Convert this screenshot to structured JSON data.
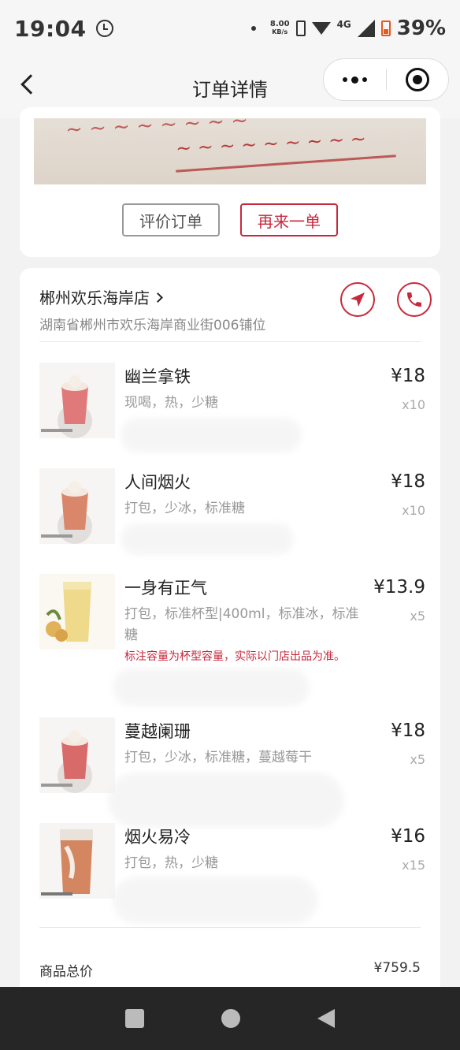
{
  "status_bar": {
    "time": "19:04",
    "net_speed_value": "8.00",
    "net_speed_unit": "KB/s",
    "network": "4G",
    "battery": "39%"
  },
  "nav": {
    "title": "订单详情"
  },
  "actions": {
    "review_label": "评价订单",
    "reorder_label": "再来一单"
  },
  "store": {
    "name": "郴州欢乐海岸店",
    "address": "湖南省郴州市欢乐海岸商业街006铺位"
  },
  "items": [
    {
      "name": "幽兰拿铁",
      "spec": "现喝，热，少糖",
      "note": "",
      "price": "¥18",
      "qty": "x10",
      "icon": "latte-drink-icon"
    },
    {
      "name": "人间烟火",
      "spec": "打包，少冰，标准糖",
      "note": "",
      "price": "¥18",
      "qty": "x10",
      "icon": "tea-drink-icon"
    },
    {
      "name": "一身有正气",
      "spec": "打包，标准杯型|400ml，标准冰，标准糖",
      "note": "标注容量为杯型容量，实际以门店出品为准。",
      "price": "¥13.9",
      "qty": "x5",
      "icon": "fruit-tea-icon"
    },
    {
      "name": "蔓越阑珊",
      "spec": "打包，少冰，标准糖，蔓越莓干",
      "note": "",
      "price": "¥18",
      "qty": "x5",
      "icon": "cranberry-drink-icon"
    },
    {
      "name": "烟火易冷",
      "spec": "打包，热，少糖",
      "note": "",
      "price": "¥16",
      "qty": "x15",
      "icon": "milk-tea-icon"
    }
  ],
  "summary": {
    "total_label": "商品总价",
    "total_value": "¥759.5"
  },
  "colors": {
    "accent": "#c8283c",
    "background": "#f2f2f2"
  }
}
